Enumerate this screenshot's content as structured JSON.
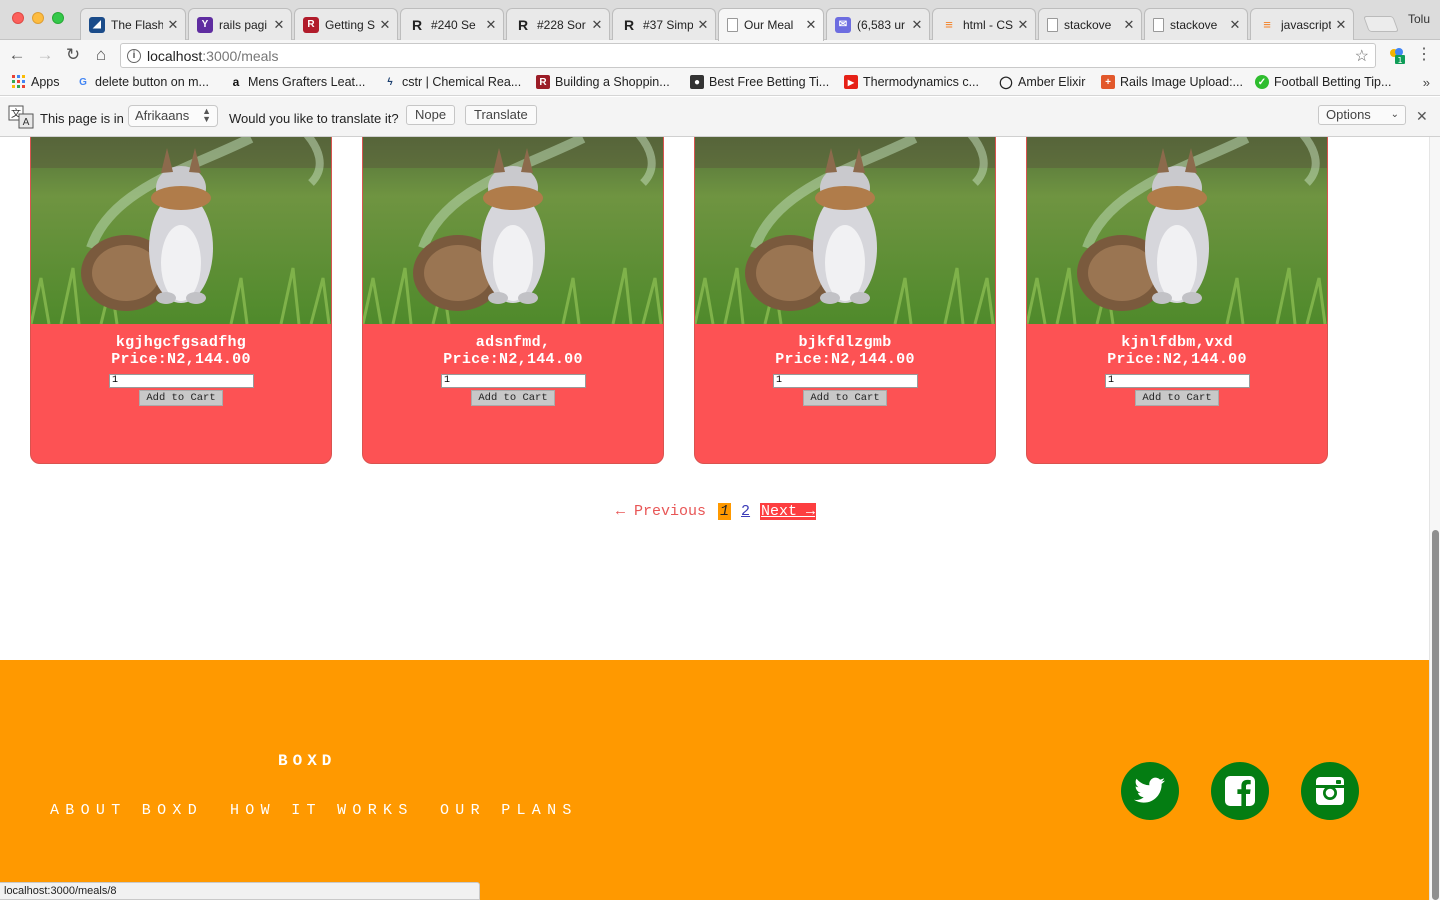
{
  "browser": {
    "tabs": [
      {
        "title": "The Flash",
        "color": "#1b4c8a"
      },
      {
        "title": "rails pagi",
        "color": "#5f2da0"
      },
      {
        "title": "Getting S",
        "color": "#b11c2b"
      },
      {
        "title": "#240 Se",
        "color": "#222222"
      },
      {
        "title": "#228 Sor",
        "color": "#222222"
      },
      {
        "title": "#37 Simp",
        "color": "#222222"
      },
      {
        "title": "Our Meal",
        "color": "#ffffff"
      },
      {
        "title": "(6,583 ur",
        "color": "#6d6de0"
      },
      {
        "title": "html - CS",
        "color": "#f48024"
      },
      {
        "title": "stackove",
        "color": "#ffffff"
      },
      {
        "title": "stackove",
        "color": "#ffffff"
      },
      {
        "title": "javascript",
        "color": "#f48024"
      }
    ],
    "profile_name": "Tolu",
    "url_host": "localhost",
    "url_rest": ":3000/meals",
    "bookmarks": [
      {
        "label": "Apps",
        "icon": "apps-grid-icon"
      },
      {
        "label": "delete button on m...",
        "icon": "google-icon"
      },
      {
        "label": "Mens Grafters Leat...",
        "icon": "amazon-icon"
      },
      {
        "label": "cstr | Chemical Rea...",
        "icon": "cstr-icon"
      },
      {
        "label": "Building a Shoppin...",
        "icon": "railscasts-icon"
      },
      {
        "label": "Best Free Betting Ti...",
        "icon": "betting-icon"
      },
      {
        "label": "Thermodynamics c...",
        "icon": "youtube-icon"
      },
      {
        "label": "Amber Elixir",
        "icon": "github-icon"
      },
      {
        "label": "Rails Image Upload:...",
        "icon": "plus-icon"
      },
      {
        "label": "Football Betting Tip...",
        "icon": "check-icon"
      }
    ],
    "translate_bar": {
      "text_before": "This page is in",
      "language": "Afrikaans",
      "question": "Would you like to translate it?",
      "nope": "Nope",
      "translate": "Translate",
      "options": "Options"
    },
    "status_url": "localhost:3000/meals/8"
  },
  "meals": [
    {
      "name": "kgjhgcfgsadfhg",
      "price": "Price:N2,144.00",
      "qty": "1",
      "button": "Add to Cart"
    },
    {
      "name": "adsnfmd,",
      "price": "Price:N2,144.00",
      "qty": "1",
      "button": "Add to Cart"
    },
    {
      "name": "bjkfdlzgmb",
      "price": "Price:N2,144.00",
      "qty": "1",
      "button": "Add to Cart"
    },
    {
      "name": "kjnlfdbm,vxd",
      "price": "Price:N2,144.00",
      "qty": "1",
      "button": "Add to Cart"
    }
  ],
  "pagination": {
    "previous": "← Previous",
    "current": "1",
    "page2": "2",
    "next": "Next →"
  },
  "footer": {
    "brand": "BOXD",
    "nav": [
      "ABOUT BOXD",
      "HOW IT WORKS",
      "OUR PLANS"
    ],
    "social": [
      "twitter",
      "facebook",
      "instagram"
    ]
  },
  "colors": {
    "card": "#fd5254",
    "footer": "#ff9900",
    "social": "#047d12",
    "current_page": "#ff9900",
    "next_button": "#fd3e40"
  }
}
